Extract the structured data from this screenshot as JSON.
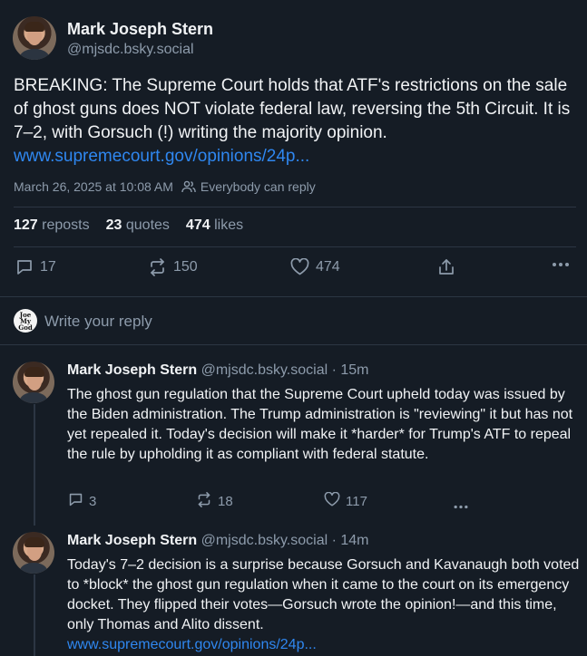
{
  "post": {
    "author_name": "Mark Joseph Stern",
    "author_handle": "@mjsdc.bsky.social",
    "text_plain": "BREAKING: The Supreme Court holds that ATF's restrictions on the sale of ghost guns does NOT violate federal law, reversing the 5th Circuit. It is 7–2, with Gorsuch (!) writing the majority opinion. ",
    "link_text": "www.supremecourt.gov/opinions/24p...",
    "timestamp": "March 26, 2025 at 10:08 AM",
    "reply_setting": "Everybody can reply",
    "stats": {
      "reposts_count": "127",
      "reposts_label": "reposts",
      "quotes_count": "23",
      "quotes_label": "quotes",
      "likes_count": "474",
      "likes_label": "likes"
    },
    "actions": {
      "reply_count": "17",
      "repost_count": "150",
      "like_count": "474"
    }
  },
  "composer": {
    "avatar_text": "Joe My God",
    "placeholder": "Write your reply"
  },
  "replies": [
    {
      "author_name": "Mark Joseph Stern",
      "author_handle": "@mjsdc.bsky.social",
      "time": "· 15m",
      "text": "The ghost gun regulation that the Supreme Court upheld today was issued by the Biden administration. The Trump administration is \"reviewing\" it but has not yet repealed it. Today's decision will make it *harder* for Trump's ATF to repeal the rule by upholding it as compliant with federal statute.",
      "reply_count": "3",
      "repost_count": "18",
      "like_count": "117"
    },
    {
      "author_name": "Mark Joseph Stern",
      "author_handle": "@mjsdc.bsky.social",
      "time": "· 14m",
      "text": "Today's 7–2 decision is a surprise because Gorsuch and Kavanaugh both voted to *block* the ghost gun regulation when it came to the court on its emergency docket. They flipped their votes—Gorsuch wrote the opinion!—and this time, only Thomas and Alito dissent.",
      "link_text": "www.supremecourt.gov/opinions/24p..."
    }
  ],
  "colors": {
    "background": "#151c25",
    "text": "#f1f3f5",
    "muted": "#8d9bab",
    "link": "#2f87f0",
    "divider": "#2c3643"
  }
}
